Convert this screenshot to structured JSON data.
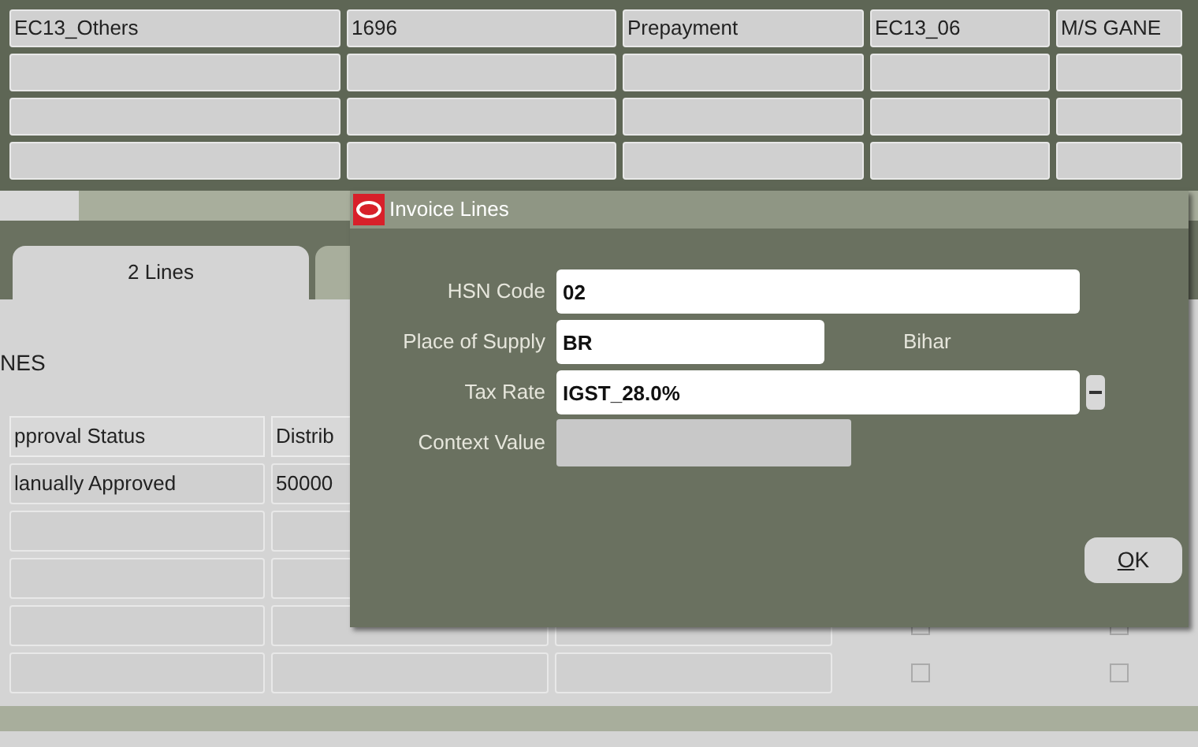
{
  "top_table": {
    "rows": [
      {
        "cells": [
          "EC13_Others",
          "1696",
          "Prepayment",
          "EC13_06",
          "M/S GANE"
        ]
      }
    ]
  },
  "tabs": [
    {
      "label": "2 Lines",
      "selected": true
    },
    {
      "selected": false
    }
  ],
  "section_heading": "NES",
  "lines_table": {
    "columns": [
      "pproval Status",
      "Distrib"
    ],
    "rows": [
      {
        "cells": [
          "lanually Approved",
          "50000"
        ]
      }
    ]
  },
  "checkboxes": [
    {
      "checked": false
    },
    {
      "checked": false
    },
    {
      "checked": false
    },
    {
      "checked": false
    }
  ],
  "dialog": {
    "title": "Invoice Lines",
    "fields": [
      {
        "kind": "text",
        "label": "HSN Code",
        "value": "02"
      },
      {
        "kind": "code",
        "label": "Place of Supply",
        "value": "BR",
        "description": "Bihar"
      },
      {
        "kind": "lov",
        "label": "Tax Rate",
        "value": "IGST_28.0%"
      },
      {
        "kind": "disabled",
        "label": "Context Value"
      }
    ],
    "ok_button": {
      "label": "OK",
      "first_letter_underlined": true
    }
  }
}
